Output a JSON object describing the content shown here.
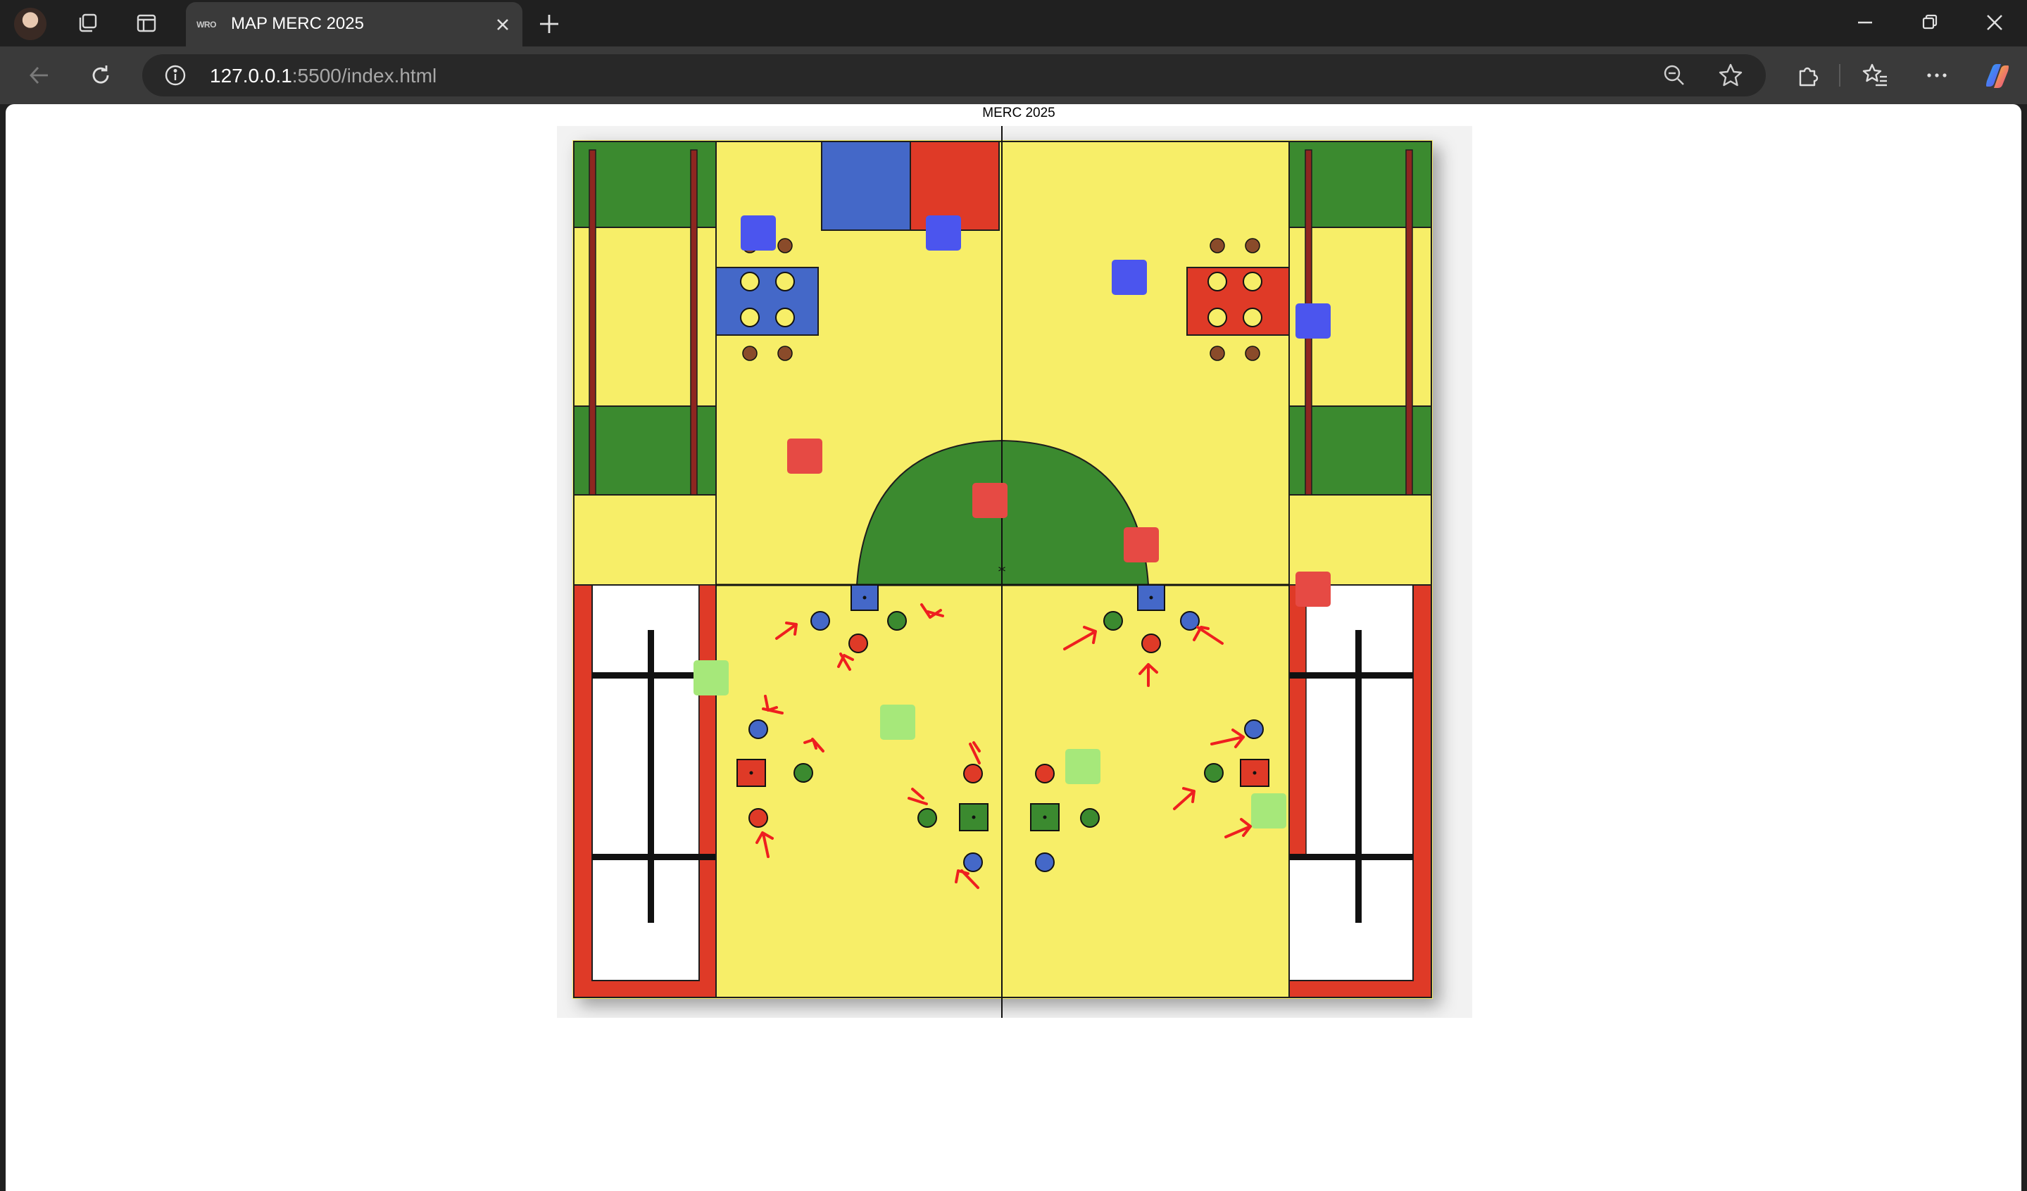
{
  "browser": {
    "tab": {
      "title": "MAP MERC 2025",
      "favicon_text": "WRO",
      "close_icon": "close-icon"
    },
    "address_bar": {
      "host": "127.0.0.1",
      "path": ":5500/index.html",
      "info_icon": "info-icon"
    },
    "toolbar_icons": [
      "back-icon",
      "reload-icon",
      "zoom-out-icon",
      "favorite-star-icon",
      "extensions-icon",
      "favorites-icon",
      "more-icon",
      "copilot-icon"
    ],
    "window_controls": [
      "minimize-icon",
      "restore-icon",
      "close-icon"
    ]
  },
  "page": {
    "heading": "MERC 2025",
    "map_image": "merc-2025-field-map",
    "colors": {
      "yellow": "#f7ee68",
      "green": "#3b8a2f",
      "red": "#df3a27",
      "blue": "#4468c8",
      "bright_blue": "#4b55ee",
      "light_red": "#e64a44",
      "light_green": "#a6e87a",
      "brown": "#8a4b2a"
    }
  }
}
